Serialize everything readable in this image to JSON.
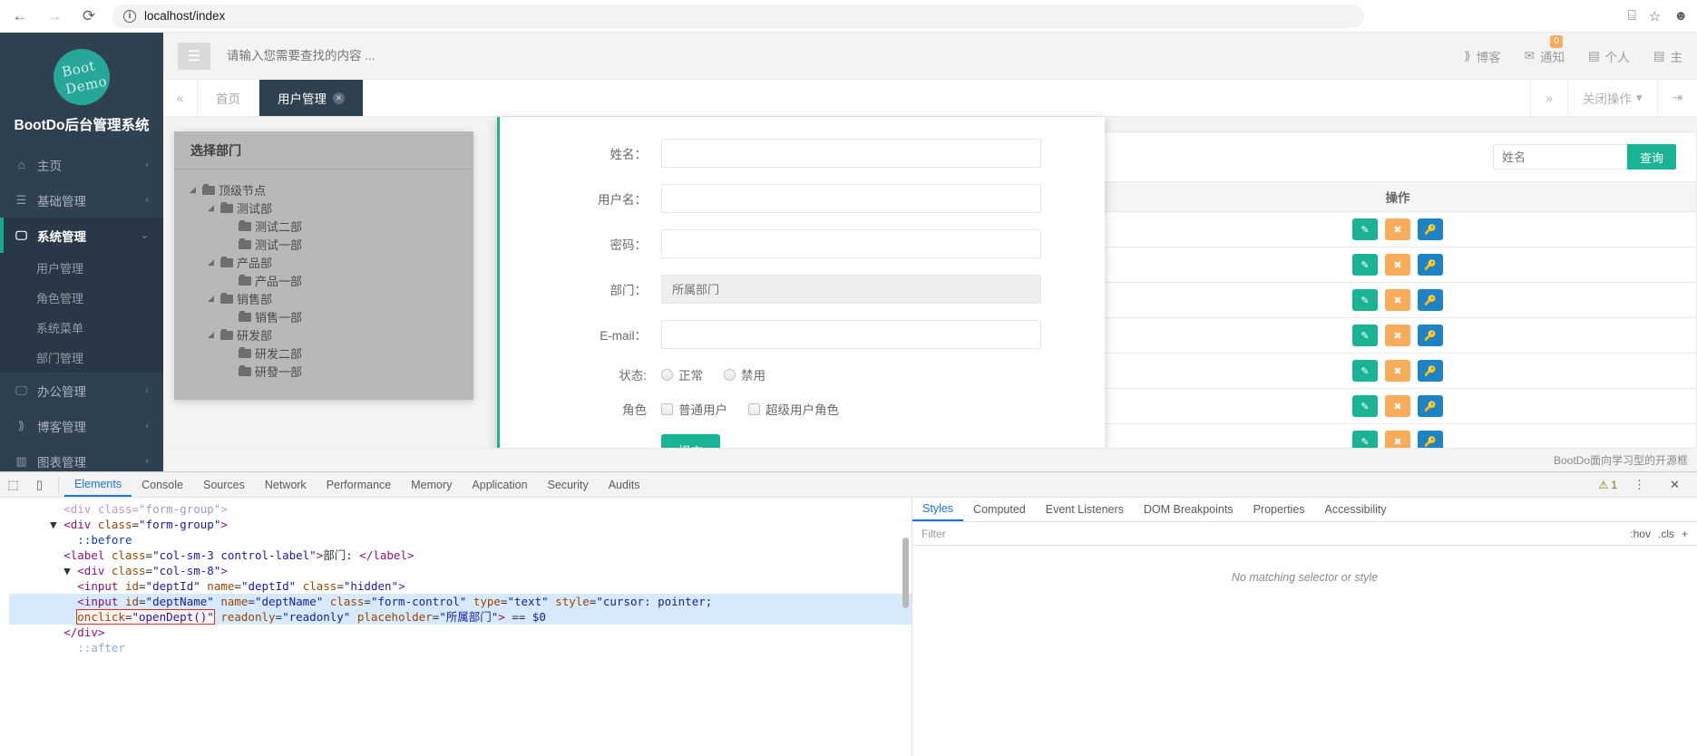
{
  "browser": {
    "back_icon": "←",
    "forward_icon": "→",
    "reload_icon": "⟳",
    "info_icon": "i",
    "url": "localhost/index",
    "ext_icon": "⌸",
    "star_icon": "☆",
    "profile_icon": "☻"
  },
  "sidebar": {
    "logo_line1": "Boot",
    "logo_line2": "Demo",
    "title": "BootDo后台管理系统",
    "items": [
      {
        "label": "主页",
        "icon": "home-icon",
        "glyph": "⌂",
        "caret": "‹"
      },
      {
        "label": "基础管理",
        "icon": "list-icon",
        "glyph": "☰",
        "caret": "‹"
      },
      {
        "label": "系统管理",
        "icon": "desktop-icon",
        "glyph": "🖵",
        "caret": "⌄"
      },
      {
        "label": "办公管理",
        "icon": "briefcase-icon",
        "glyph": "🖵",
        "caret": "‹"
      },
      {
        "label": "博客管理",
        "icon": "rss-icon",
        "glyph": "⟫",
        "caret": "‹"
      },
      {
        "label": "图表管理",
        "icon": "chart-icon",
        "glyph": "▥",
        "caret": "‹"
      }
    ],
    "submenu": [
      "用户管理",
      "角色管理",
      "系统菜单",
      "部门管理"
    ]
  },
  "topbar": {
    "menu_toggle_icon": "☰",
    "search_placeholder": "请输入您需要查找的内容 ...",
    "links": [
      {
        "label": "博客",
        "icon": "rss-icon",
        "glyph": "⟫",
        "badge": ""
      },
      {
        "label": "通知",
        "icon": "envelope-icon",
        "glyph": "✉",
        "badge": "0"
      },
      {
        "label": "个人",
        "icon": "id-card-icon",
        "glyph": "▤",
        "badge": ""
      },
      {
        "label": "主",
        "icon": "lines-icon",
        "glyph": "▤",
        "badge": ""
      }
    ]
  },
  "tabs": {
    "scroll_left_icon": "«",
    "scroll_right_icon": "»",
    "items": [
      {
        "label": "首页",
        "active": false,
        "closable": false
      },
      {
        "label": "用户管理",
        "active": true,
        "closable": true
      }
    ],
    "close_ops_label": "关闭操作",
    "close_ops_caret": "▾",
    "logout_icon": "⇥"
  },
  "table_panel": {
    "search_value": "",
    "search_placeholder": "姓名",
    "search_button": "查询",
    "column_header": "操作",
    "row_actions": [
      {
        "edit_icon": "✎",
        "delete_icon": "✖",
        "key_icon": "🔑"
      },
      {
        "edit_icon": "✎",
        "delete_icon": "✖",
        "key_icon": "🔑"
      },
      {
        "edit_icon": "✎",
        "delete_icon": "✖",
        "key_icon": "🔑"
      },
      {
        "edit_icon": "✎",
        "delete_icon": "✖",
        "key_icon": "🔑"
      },
      {
        "edit_icon": "✎",
        "delete_icon": "✖",
        "key_icon": "🔑"
      },
      {
        "edit_icon": "✎",
        "delete_icon": "✖",
        "key_icon": "🔑"
      },
      {
        "edit_icon": "✎",
        "delete_icon": "✖",
        "key_icon": "🔑"
      }
    ],
    "colors": {
      "edit": "#1ab394",
      "delete": "#f8ac59",
      "key": "#1c84c6"
    }
  },
  "dept_modal": {
    "title": "选择部门",
    "tree": [
      {
        "label": "顶级节点",
        "depth": 0,
        "switcher": "◢"
      },
      {
        "label": "测试部",
        "depth": 1,
        "switcher": "◢"
      },
      {
        "label": "测试二部",
        "depth": 2,
        "switcher": ""
      },
      {
        "label": "测试一部",
        "depth": 2,
        "switcher": ""
      },
      {
        "label": "产品部",
        "depth": 1,
        "switcher": "◢"
      },
      {
        "label": "产品一部",
        "depth": 2,
        "switcher": ""
      },
      {
        "label": "销售部",
        "depth": 1,
        "switcher": "◢"
      },
      {
        "label": "销售一部",
        "depth": 2,
        "switcher": ""
      },
      {
        "label": "研发部",
        "depth": 1,
        "switcher": "◢"
      },
      {
        "label": "研发二部",
        "depth": 2,
        "switcher": ""
      },
      {
        "label": "研發一部",
        "depth": 2,
        "switcher": ""
      }
    ]
  },
  "user_form": {
    "fields": [
      {
        "label": "姓名：",
        "value": "",
        "placeholder": "",
        "readonly": false
      },
      {
        "label": "用户名：",
        "value": "",
        "placeholder": "",
        "readonly": false
      },
      {
        "label": "密码：",
        "value": "",
        "placeholder": "",
        "readonly": false
      },
      {
        "label": "部门：",
        "value": "",
        "placeholder": "所属部门",
        "readonly": true
      },
      {
        "label": "E-mail：",
        "value": "",
        "placeholder": "",
        "readonly": false
      }
    ],
    "status_label": "状态:",
    "status_options": [
      {
        "label": "正常",
        "checked": false
      },
      {
        "label": "禁用",
        "checked": false
      }
    ],
    "role_label": "角色",
    "role_options": [
      {
        "label": "普通用户",
        "checked": false
      },
      {
        "label": "超级用户角色",
        "checked": false
      }
    ],
    "submit_label": "提交",
    "submit_color": "#1ab394"
  },
  "footer": {
    "text": "BootDo面向学习型的开源框"
  },
  "devtools": {
    "inspect_icon": "⬚",
    "device_icon": "▯",
    "tabs": [
      {
        "label": "Elements",
        "active": true
      },
      {
        "label": "Console",
        "active": false
      },
      {
        "label": "Sources",
        "active": false
      },
      {
        "label": "Network",
        "active": false
      },
      {
        "label": "Performance",
        "active": false
      },
      {
        "label": "Memory",
        "active": false
      },
      {
        "label": "Application",
        "active": false
      },
      {
        "label": "Security",
        "active": false
      },
      {
        "label": "Audits",
        "active": false
      }
    ],
    "warning_icon": "⚠",
    "warning_count": "1",
    "more_icon": "⋮",
    "close_icon": "✕",
    "dom_lines": [
      {
        "indent": 4,
        "html": "<span class=\"tg\">&lt;div class=</span><span class=\"av\">\"form-group\"</span><span class=\"tg\">&gt;</span>",
        "faded": true
      },
      {
        "indent": 3,
        "html": "▼ <span class=\"tg\">&lt;div</span> <span class=\"at\">class</span>=<span class=\"av\">\"form-group\"</span><span class=\"tg\">&gt;</span>"
      },
      {
        "indent": 5,
        "html": "<span class=\"pseudo\">::before</span>"
      },
      {
        "indent": 4,
        "html": "<span class=\"tg\">&lt;label</span> <span class=\"at\">class</span>=<span class=\"av\">\"col-sm-3 control-label\"</span><span class=\"tg\">&gt;</span>部门: <span class=\"tg\">&lt;/label&gt;</span>"
      },
      {
        "indent": 4,
        "html": "▼ <span class=\"tg\">&lt;div</span> <span class=\"at\">class</span>=<span class=\"av\">\"col-sm-8\"</span><span class=\"tg\">&gt;</span>"
      },
      {
        "indent": 5,
        "html": "<span class=\"tg\">&lt;input</span> <span class=\"at\">id</span>=<span class=\"av\">\"deptId\"</span> <span class=\"at\">name</span>=<span class=\"av\">\"deptId\"</span> <span class=\"at\">class</span>=<span class=\"av\">\"hidden\"</span><span class=\"tg\">&gt;</span>"
      },
      {
        "indent": 5,
        "html": "<span class=\"tg\">&lt;input</span> <span class=\"at\">id</span>=<span class=\"av\">\"deptName\"</span> <span class=\"at\">name</span>=<span class=\"av\">\"deptName\"</span> <span class=\"at\">class</span>=<span class=\"av\">\"form-control\"</span> <span class=\"at\">type</span>=<span class=\"av\">\"text\"</span> <span class=\"at\">style</span>=<span class=\"av\">\"cursor: pointer;</span>",
        "selected": true
      },
      {
        "indent": 5,
        "html": "<span class=\"hl-box\"><span class=\"at\">onclick</span>=<span class=\"av\">\"openDept()\"</span></span> <span class=\"at\">readonly</span>=<span class=\"av\">\"readonly\"</span> <span class=\"at\">placeholder</span>=<span class=\"av\">\"所属部门\"</span><span class=\"tg\">&gt;</span> == <span class=\"av\">$0</span>",
        "selected": true
      },
      {
        "indent": 4,
        "html": "<span class=\"tg\">&lt;/div&gt;</span>"
      },
      {
        "indent": 5,
        "html": "<span class=\"pseudo\">::after</span>",
        "faded": true
      }
    ],
    "side_tabs": [
      {
        "label": "Styles",
        "active": true
      },
      {
        "label": "Computed",
        "active": false
      },
      {
        "label": "Event Listeners",
        "active": false
      },
      {
        "label": "DOM Breakpoints",
        "active": false
      },
      {
        "label": "Properties",
        "active": false
      },
      {
        "label": "Accessibility",
        "active": false
      }
    ],
    "filter_placeholder": "Filter",
    "filter_hov": ":hov",
    "filter_cls": ".cls",
    "filter_plus": "+",
    "no_match": "No matching selector or style"
  }
}
